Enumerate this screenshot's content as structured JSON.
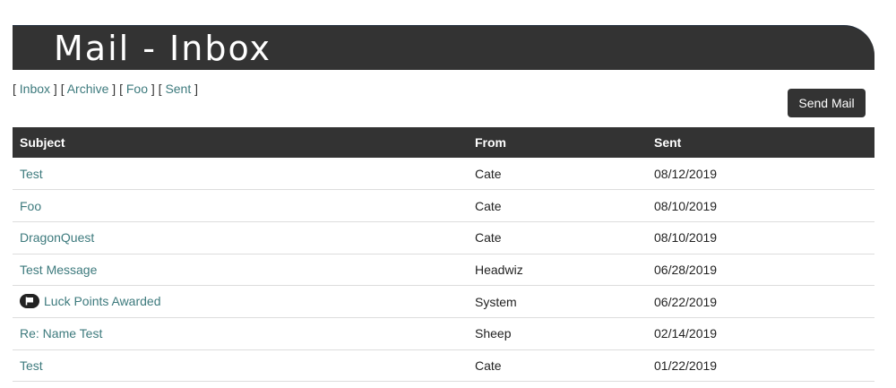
{
  "header": {
    "title": "Mail - Inbox"
  },
  "folders": [
    {
      "label": "Inbox"
    },
    {
      "label": "Archive"
    },
    {
      "label": "Foo"
    },
    {
      "label": "Sent"
    }
  ],
  "send_button": {
    "label": "Send Mail"
  },
  "table": {
    "columns": [
      "Subject",
      "From",
      "Sent"
    ],
    "rows": [
      {
        "subject": "Test",
        "from": "Cate",
        "sent": "08/12/2019"
      },
      {
        "subject": "Foo",
        "from": "Cate",
        "sent": "08/10/2019"
      },
      {
        "subject": "DragonQuest",
        "from": "Cate",
        "sent": "08/10/2019"
      },
      {
        "subject": "Test Message",
        "from": "Headwiz",
        "sent": "06/28/2019"
      },
      {
        "subject": "Luck Points Awarded",
        "from": "System",
        "sent": "06/22/2019",
        "icon": "flag-icon"
      },
      {
        "subject": "Re: Name Test",
        "from": "Sheep",
        "sent": "02/14/2019"
      },
      {
        "subject": "Test",
        "from": "Cate",
        "sent": "01/22/2019"
      }
    ]
  },
  "colors": {
    "header_bg": "#333333",
    "link": "#3d7a7d",
    "button_bg": "#333333"
  }
}
